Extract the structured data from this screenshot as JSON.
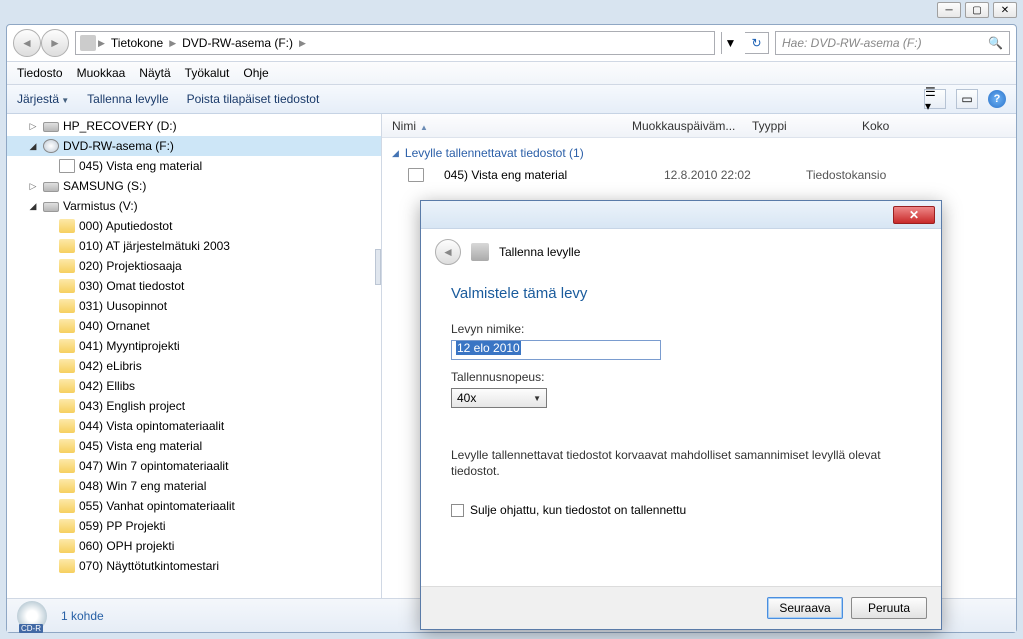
{
  "window_controls": {
    "min": "─",
    "max": "▢",
    "close": "✕"
  },
  "breadcrumb": {
    "root": "Tietokone",
    "current": "DVD-RW-asema (F:)"
  },
  "search": {
    "placeholder": "Hae: DVD-RW-asema (F:)"
  },
  "menu": {
    "file": "Tiedosto",
    "edit": "Muokkaa",
    "view": "Näytä",
    "tools": "Työkalut",
    "help": "Ohje"
  },
  "toolbar": {
    "organize": "Järjestä",
    "burn": "Tallenna levylle",
    "delete_temp": "Poista tilapäiset tiedostot"
  },
  "tree": {
    "items": [
      {
        "indent": 1,
        "arrow": "▷",
        "icon": "drive",
        "label": "HP_RECOVERY (D:)"
      },
      {
        "indent": 1,
        "arrow": "◢",
        "icon": "dvd",
        "label": "DVD-RW-asema (F:)",
        "selected": true
      },
      {
        "indent": 2,
        "arrow": "",
        "icon": "file",
        "label": "045) Vista eng material"
      },
      {
        "indent": 1,
        "arrow": "▷",
        "icon": "drive",
        "label": "SAMSUNG (S:)"
      },
      {
        "indent": 1,
        "arrow": "◢",
        "icon": "drive",
        "label": "Varmistus (V:)"
      },
      {
        "indent": 2,
        "arrow": "",
        "icon": "folder",
        "label": "000) Aputiedostot"
      },
      {
        "indent": 2,
        "arrow": "",
        "icon": "folder",
        "label": "010) AT järjestelmätuki 2003"
      },
      {
        "indent": 2,
        "arrow": "",
        "icon": "folder",
        "label": "020) Projektiosaaja"
      },
      {
        "indent": 2,
        "arrow": "",
        "icon": "folder",
        "label": "030) Omat tiedostot"
      },
      {
        "indent": 2,
        "arrow": "",
        "icon": "folder",
        "label": "031) Uusopinnot"
      },
      {
        "indent": 2,
        "arrow": "",
        "icon": "folder",
        "label": "040) Ornanet"
      },
      {
        "indent": 2,
        "arrow": "",
        "icon": "folder",
        "label": "041) Myyntiprojekti"
      },
      {
        "indent": 2,
        "arrow": "",
        "icon": "folder",
        "label": "042) eLibris"
      },
      {
        "indent": 2,
        "arrow": "",
        "icon": "folder",
        "label": "042) Ellibs"
      },
      {
        "indent": 2,
        "arrow": "",
        "icon": "folder",
        "label": "043) English project"
      },
      {
        "indent": 2,
        "arrow": "",
        "icon": "folder",
        "label": "044) Vista opintomateriaalit"
      },
      {
        "indent": 2,
        "arrow": "",
        "icon": "folder",
        "label": "045) Vista eng material"
      },
      {
        "indent": 2,
        "arrow": "",
        "icon": "folder",
        "label": "047) Win 7 opintomateriaalit"
      },
      {
        "indent": 2,
        "arrow": "",
        "icon": "folder",
        "label": "048) Win 7 eng material"
      },
      {
        "indent": 2,
        "arrow": "",
        "icon": "folder",
        "label": "055) Vanhat opintomateriaalit"
      },
      {
        "indent": 2,
        "arrow": "",
        "icon": "folder",
        "label": "059) PP Projekti"
      },
      {
        "indent": 2,
        "arrow": "",
        "icon": "folder",
        "label": "060) OPH projekti"
      },
      {
        "indent": 2,
        "arrow": "",
        "icon": "folder",
        "label": "070) Näyttötutkintomestari"
      }
    ]
  },
  "columns": {
    "name": "Nimi",
    "date": "Muokkauspäiväm...",
    "type": "Tyyppi",
    "size": "Koko"
  },
  "group": {
    "title": "Levylle tallennettavat tiedostot (1)"
  },
  "files": [
    {
      "name": "045) Vista eng material",
      "date": "12.8.2010 22:02",
      "type": "Tiedostokansio"
    }
  ],
  "status": {
    "disc_label": "CD-R",
    "text": "1 kohde"
  },
  "dialog": {
    "title": "Tallenna levylle",
    "heading": "Valmistele tämä levy",
    "label_name": "Levyn nimike:",
    "input_name": "12 elo 2010",
    "label_speed": "Tallennusnopeus:",
    "speed_value": "40x",
    "note": "Levylle tallennettavat tiedostot korvaavat mahdolliset samannimiset levyllä olevat tiedostot.",
    "checkbox": "Sulje ohjattu, kun tiedostot on tallennettu",
    "btn_next": "Seuraava",
    "btn_cancel": "Peruuta"
  }
}
